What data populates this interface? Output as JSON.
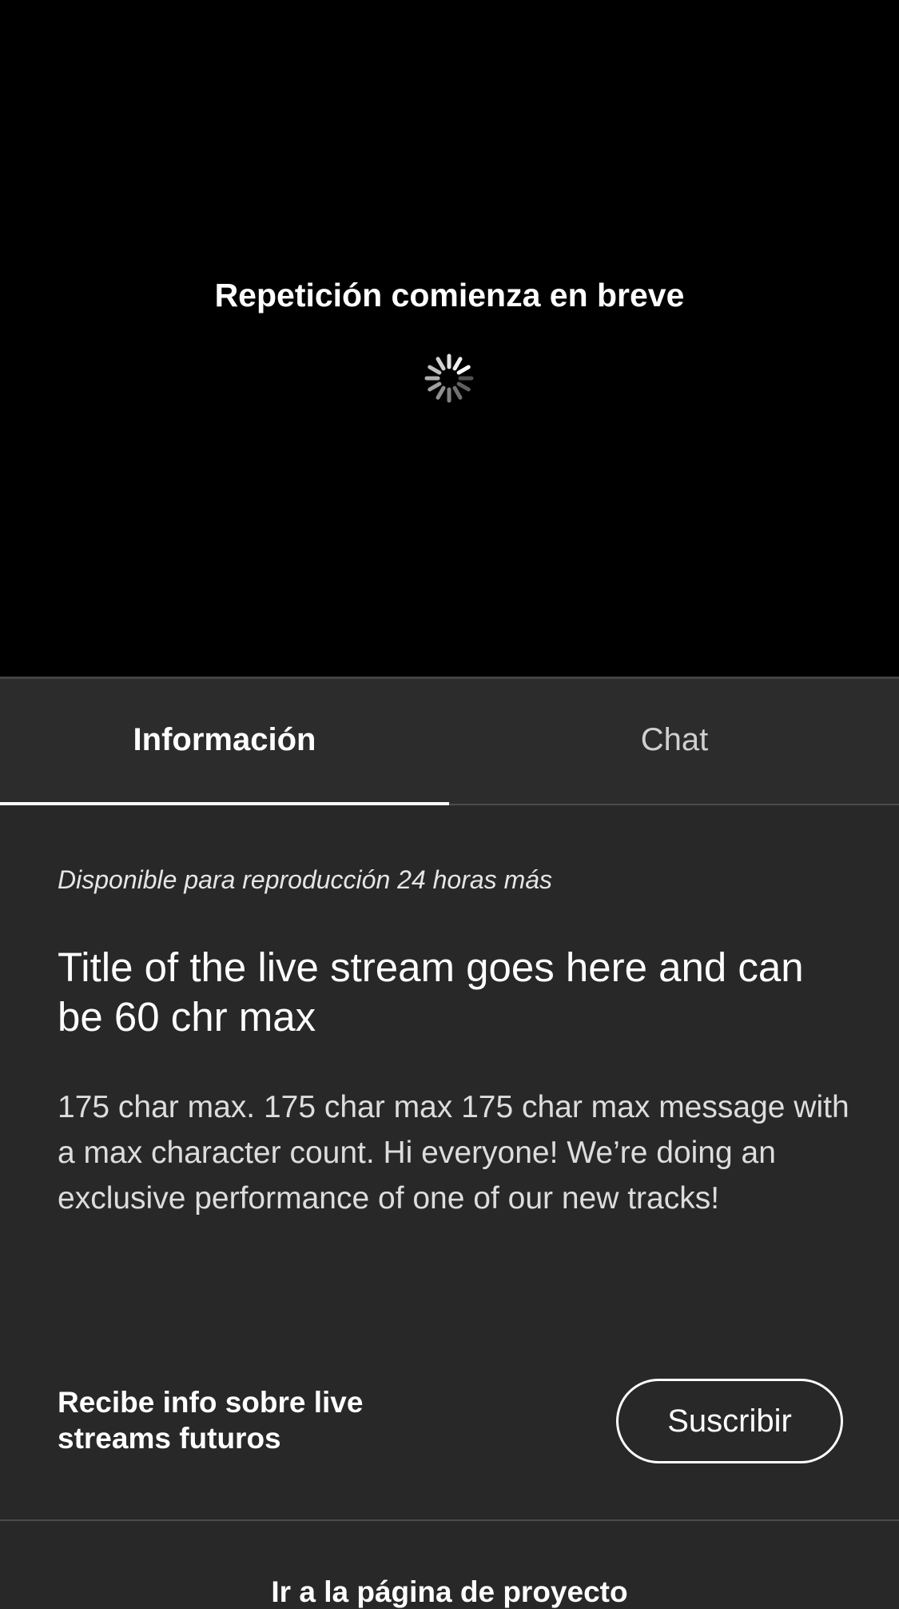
{
  "player": {
    "message": "Repetición comienza en breve",
    "spinner_icon": "loading-spinner-icon"
  },
  "tabs": [
    {
      "label": "Información",
      "selected": true
    },
    {
      "label": "Chat",
      "selected": false
    }
  ],
  "info": {
    "availability": "Disponible para reproducción 24 horas más",
    "title": "Title of the live stream goes here and can be 60 chr max",
    "description": "175 char max. 175 char max 175 char max message with a max character count. Hi everyone! We’re doing an exclusive performance of one of our new tracks!",
    "subscribe_prompt": "Recibe info sobre live streams futuros",
    "subscribe_button": "Suscribir",
    "project_link": "Ir a la página de proyecto"
  },
  "colors": {
    "player_bg": "#000000",
    "panel_bg": "#282828",
    "text_primary": "#ffffff",
    "divider": "#4c4c4c"
  }
}
